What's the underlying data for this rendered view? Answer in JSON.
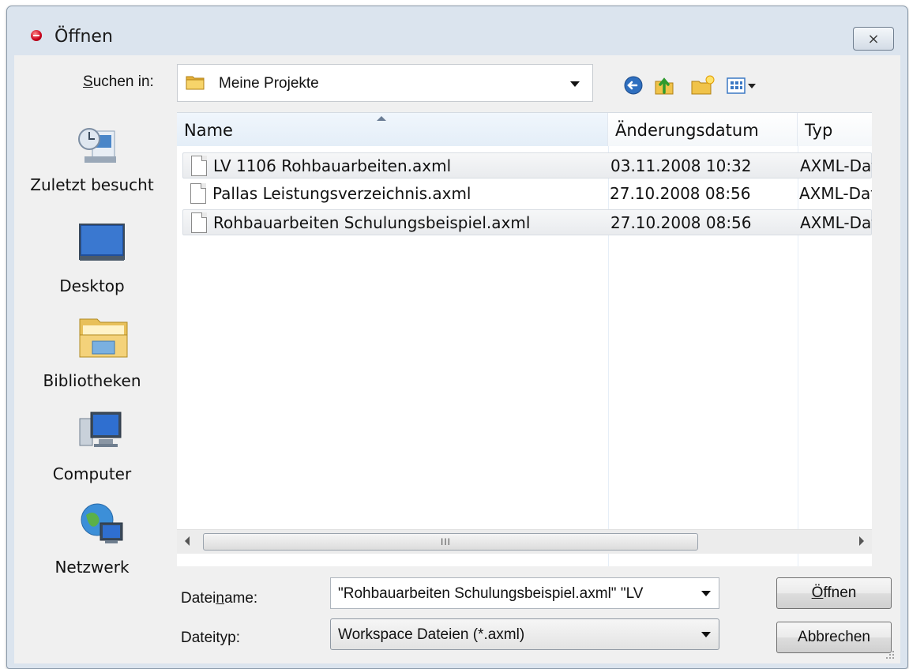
{
  "window": {
    "title": "Öffnen",
    "close_label": "⨯"
  },
  "lookin": {
    "label_pre": "",
    "label_u": "S",
    "label_post": "uchen in:",
    "value": "Meine Projekte"
  },
  "places": [
    {
      "label": "Zuletzt besucht",
      "icon": "recent-places-icon"
    },
    {
      "label": "Desktop",
      "icon": "desktop-icon"
    },
    {
      "label": "Bibliotheken",
      "icon": "libraries-icon"
    },
    {
      "label": "Computer",
      "icon": "computer-icon"
    },
    {
      "label": "Netzwerk",
      "icon": "network-icon"
    }
  ],
  "filelist": {
    "columns": [
      "Name",
      "Änderungsdatum",
      "Typ"
    ],
    "rows": [
      {
        "name": "LV 1106 Rohbauarbeiten.axml",
        "date": "03.11.2008 10:32",
        "type": "AXML-Dat",
        "selected": true
      },
      {
        "name": "Pallas Leistungsverzeichnis.axml",
        "date": "27.10.2008 08:56",
        "type": "AXML-Dat",
        "selected": false
      },
      {
        "name": "Rohbauarbeiten Schulungsbeispiel.axml",
        "date": "27.10.2008 08:56",
        "type": "AXML-Dat",
        "selected": true
      }
    ]
  },
  "scrollbar": {
    "grip": "III"
  },
  "filename": {
    "label_pre": "Datei",
    "label_u": "n",
    "label_post": "ame:",
    "value": "\"Rohbauarbeiten Schulungsbeispiel.axml\" \"LV"
  },
  "filetype": {
    "label": "Dateityp:",
    "value": "Workspace Dateien (*.axml)"
  },
  "buttons": {
    "open_u": "Ö",
    "open_post": "ffnen",
    "cancel": "Abbrechen"
  }
}
